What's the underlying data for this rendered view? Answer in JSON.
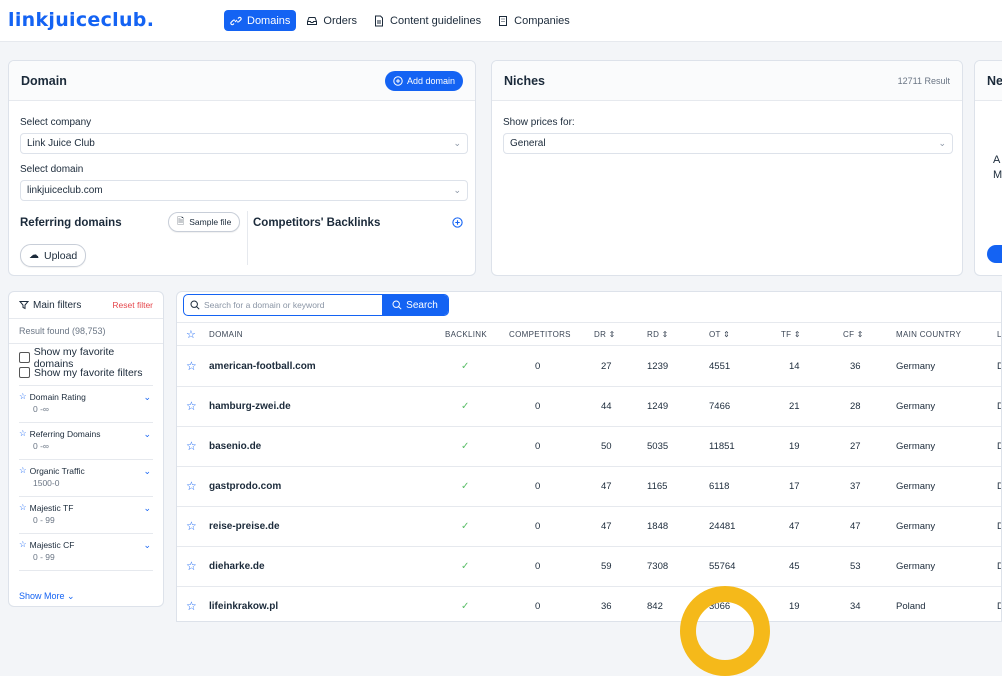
{
  "app": {
    "logo": "linkjuiceclub."
  },
  "nav": [
    {
      "label": "Domains",
      "icon": "link-icon",
      "active": true
    },
    {
      "label": "Orders",
      "icon": "inbox-icon",
      "active": false
    },
    {
      "label": "Content guidelines",
      "icon": "document-icon",
      "active": false
    },
    {
      "label": "Companies",
      "icon": "building-icon",
      "active": false
    }
  ],
  "domain_card": {
    "title": "Domain",
    "add_label": "Add domain",
    "company_label": "Select company",
    "company_value": "Link Juice Club",
    "domain_label": "Select domain",
    "domain_value": "linkjuiceclub.com",
    "referring": "Referring domains",
    "sample": "Sample file",
    "competitors": "Competitors' Backlinks",
    "upload": "Upload"
  },
  "niches_card": {
    "title": "Niches",
    "result": "12711 Result",
    "show_prices": "Show prices for:",
    "value": "General"
  },
  "third_card": {
    "title": "Ne",
    "line1": "A",
    "line2": "M"
  },
  "filters": {
    "title": "Main filters",
    "reset": "Reset filter",
    "result": "Result found (98,753)",
    "fav_domains": "Show my favorite domains",
    "fav_filters": "Show my favorite filters",
    "items": [
      {
        "name": "Domain Rating",
        "range": "0 -∞"
      },
      {
        "name": "Referring Domains",
        "range": "0 -∞"
      },
      {
        "name": "Organic Traffic",
        "range": "1500-0"
      },
      {
        "name": "Majestic TF",
        "range": "0 - 99"
      },
      {
        "name": "Majestic CF",
        "range": "0 - 99"
      }
    ],
    "show_more": "Show More"
  },
  "search": {
    "placeholder": "Search for a domain or keyword",
    "button": "Search"
  },
  "table": {
    "headers": {
      "domain": "DOMAIN",
      "backlink": "BACKLINK",
      "competitors": "COMPETITORS",
      "dr": "DR",
      "rd": "RD",
      "ot": "OT",
      "tf": "TF",
      "cf": "CF",
      "country": "MAIN COUNTRY",
      "last": "L"
    },
    "rows": [
      {
        "domain": "american-football.com",
        "backlink": "✓",
        "competitors": "0",
        "dr": "27",
        "rd": "1239",
        "ot": "4551",
        "tf": "14",
        "cf": "36",
        "country": "Germany",
        "last": "D"
      },
      {
        "domain": "hamburg-zwei.de",
        "backlink": "✓",
        "competitors": "0",
        "dr": "44",
        "rd": "1249",
        "ot": "7466",
        "tf": "21",
        "cf": "28",
        "country": "Germany",
        "last": "D"
      },
      {
        "domain": "basenio.de",
        "backlink": "✓",
        "competitors": "0",
        "dr": "50",
        "rd": "5035",
        "ot": "11851",
        "tf": "19",
        "cf": "27",
        "country": "Germany",
        "last": "D"
      },
      {
        "domain": "gastprodo.com",
        "backlink": "✓",
        "competitors": "0",
        "dr": "47",
        "rd": "1165",
        "ot": "6118",
        "tf": "17",
        "cf": "37",
        "country": "Germany",
        "last": "D"
      },
      {
        "domain": "reise-preise.de",
        "backlink": "✓",
        "competitors": "0",
        "dr": "47",
        "rd": "1848",
        "ot": "24481",
        "tf": "47",
        "cf": "47",
        "country": "Germany",
        "last": "D"
      },
      {
        "domain": "dieharke.de",
        "backlink": "✓",
        "competitors": "0",
        "dr": "59",
        "rd": "7308",
        "ot": "55764",
        "tf": "45",
        "cf": "53",
        "country": "Germany",
        "last": "D"
      },
      {
        "domain": "lifeinkrakow.pl",
        "backlink": "✓",
        "competitors": "0",
        "dr": "36",
        "rd": "842",
        "ot": "3066",
        "tf": "19",
        "cf": "34",
        "country": "Poland",
        "last": "D"
      }
    ]
  },
  "colors": {
    "accent": "#1463f3",
    "highlight": "#f5b91a",
    "reset": "#e5484d",
    "tick": "#5cbf6a"
  }
}
